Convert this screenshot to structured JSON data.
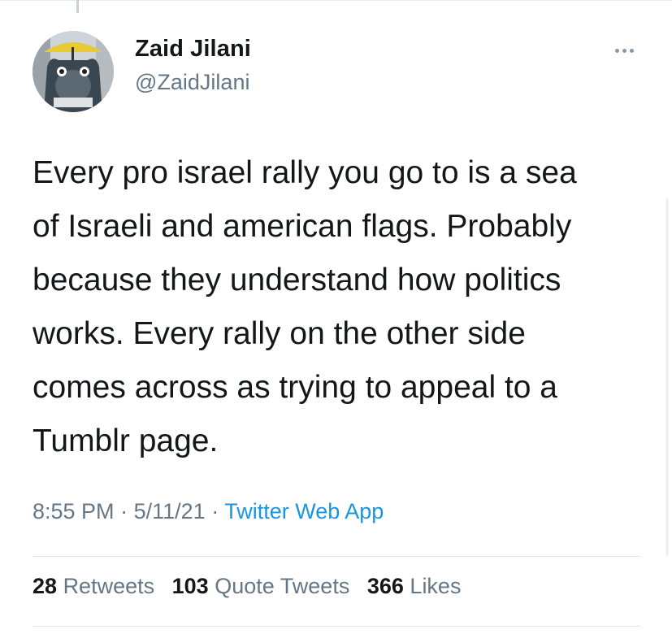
{
  "author": {
    "display_name": "Zaid Jilani",
    "handle": "@ZaidJilani"
  },
  "tweet": {
    "text": "Every pro israel rally you go to is a sea\nof Israeli and american flags. Probably\nbecause they understand how politics\nworks. Every rally on the other side\ncomes across as trying to appeal to a\nTumblr page.",
    "time": "8:55 PM",
    "date": "5/11/21",
    "separator": "·",
    "source": "Twitter Web App"
  },
  "stats": {
    "retweets_count": "28",
    "retweets_label": "Retweets",
    "quote_count": "103",
    "quote_label": "Quote Tweets",
    "likes_count": "366",
    "likes_label": "Likes"
  },
  "icons": {
    "more": "more-horizontal-icon"
  },
  "colors": {
    "text_primary": "#14171a",
    "text_secondary": "#657786",
    "link": "#1b95e0",
    "divider": "#e1e8ed"
  }
}
